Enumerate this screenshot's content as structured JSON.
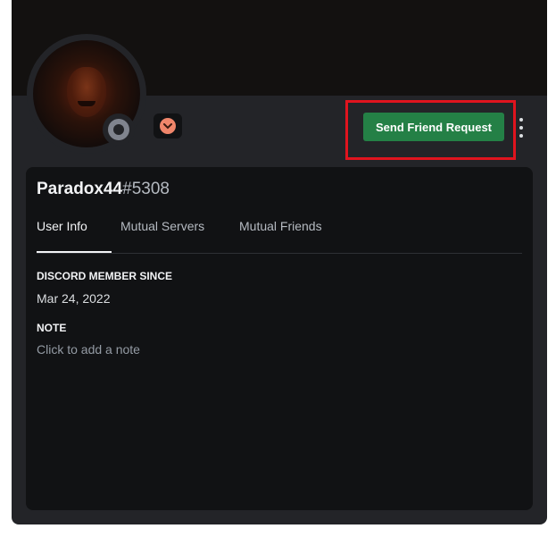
{
  "profile": {
    "username": "Paradox44",
    "discriminator": "#5308",
    "status": "offline",
    "badge_icon": "chevron-down-icon"
  },
  "actions": {
    "send_friend_request_label": "Send Friend Request",
    "more_icon": "more-vertical-icon"
  },
  "tabs": [
    {
      "label": "User Info",
      "active": true
    },
    {
      "label": "Mutual Servers",
      "active": false
    },
    {
      "label": "Mutual Friends",
      "active": false
    }
  ],
  "user_info": {
    "member_since_title": "DISCORD MEMBER SINCE",
    "member_since_value": "Mar 24, 2022",
    "note_title": "NOTE",
    "note_placeholder": "Click to add a note"
  },
  "colors": {
    "accent_button": "#248046",
    "highlight_border": "#e0141e",
    "badge": "#f0866b"
  }
}
